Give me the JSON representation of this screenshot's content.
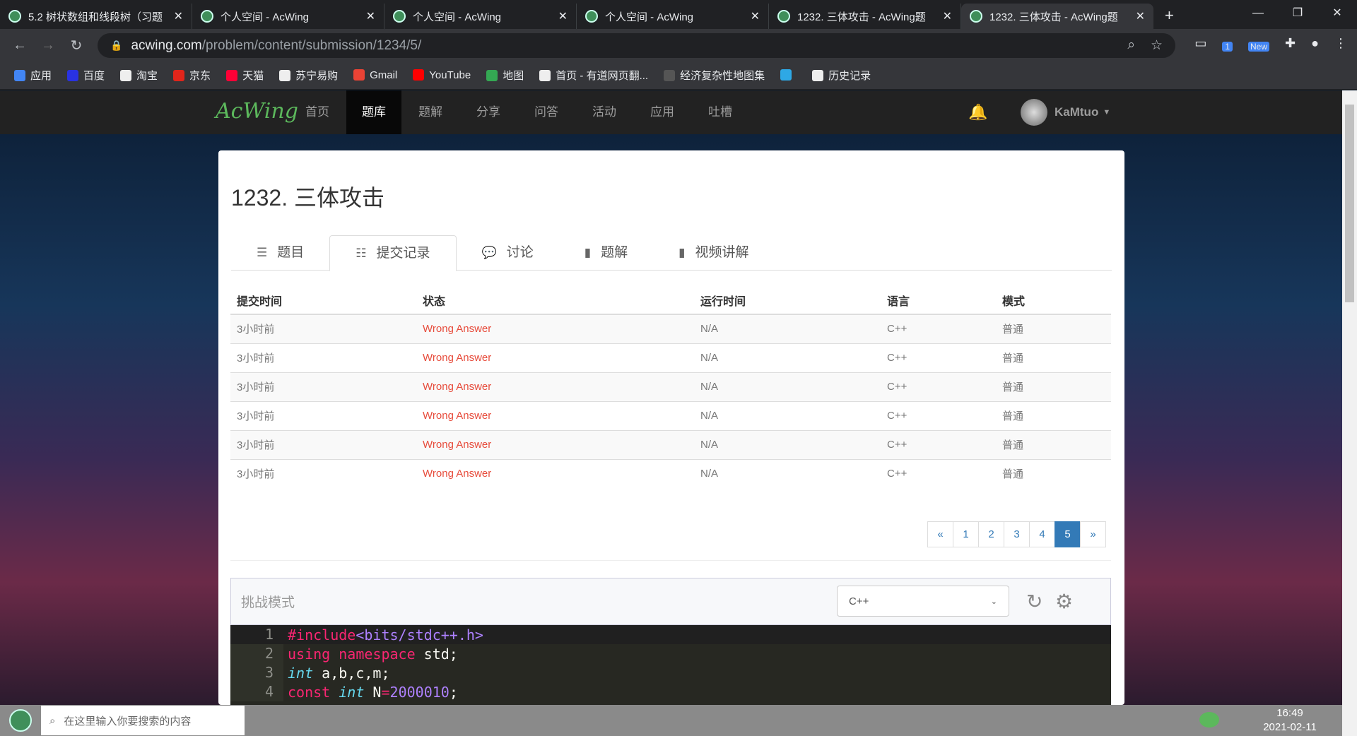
{
  "browser": {
    "tabs": [
      {
        "title": "5.2 树状数组和线段树（习题"
      },
      {
        "title": "个人空间 - AcWing"
      },
      {
        "title": "个人空间 - AcWing"
      },
      {
        "title": "个人空间 - AcWing"
      },
      {
        "title": "1232. 三体攻击 - AcWing题"
      },
      {
        "title": "1232. 三体攻击 - AcWing题",
        "active": true
      }
    ],
    "url_host": "acwing.com",
    "url_path": "/problem/content/submission/1234/5/",
    "bookmarks": [
      {
        "label": "应用",
        "color": "#4285f4"
      },
      {
        "label": "百度",
        "color": "#2932e1"
      },
      {
        "label": "淘宝",
        "color": "#eee"
      },
      {
        "label": "京东",
        "color": "#e1251b"
      },
      {
        "label": "天猫",
        "color": "#ff0036"
      },
      {
        "label": "苏宁易购",
        "color": "#eee"
      },
      {
        "label": "Gmail",
        "color": "#ea4335"
      },
      {
        "label": "YouTube",
        "color": "#ff0000"
      },
      {
        "label": "地图",
        "color": "#34a853"
      },
      {
        "label": "首页 - 有道网页翻...",
        "color": "#eee"
      },
      {
        "label": "经济复杂性地图集",
        "color": "#555"
      },
      {
        "label": "",
        "color": "#2ea8e5"
      },
      {
        "label": "历史记录",
        "color": "#eee"
      }
    ],
    "ext_badge": "1",
    "ext_new": "New"
  },
  "site": {
    "logo": "AcWing",
    "menu": [
      "首页",
      "题库",
      "题解",
      "分享",
      "问答",
      "活动",
      "应用",
      "吐槽"
    ],
    "active_menu": "题库",
    "username": "KaMtuo"
  },
  "problem": {
    "title": "1232. 三体攻击",
    "tabs": [
      "题目",
      "提交记录",
      "讨论",
      "题解",
      "视频讲解"
    ],
    "active_tab": "提交记录",
    "columns": [
      "提交时间",
      "状态",
      "运行时间",
      "语言",
      "模式"
    ],
    "rows": [
      [
        "3小时前",
        "Wrong Answer",
        "N/A",
        "C++",
        "普通"
      ],
      [
        "3小时前",
        "Wrong Answer",
        "N/A",
        "C++",
        "普通"
      ],
      [
        "3小时前",
        "Wrong Answer",
        "N/A",
        "C++",
        "普通"
      ],
      [
        "3小时前",
        "Wrong Answer",
        "N/A",
        "C++",
        "普通"
      ],
      [
        "3小时前",
        "Wrong Answer",
        "N/A",
        "C++",
        "普通"
      ],
      [
        "3小时前",
        "Wrong Answer",
        "N/A",
        "C++",
        "普通"
      ]
    ],
    "pagination": [
      "«",
      "1",
      "2",
      "3",
      "4",
      "5",
      "»"
    ],
    "current_page": "5"
  },
  "editor": {
    "mode_label": "挑战模式",
    "language": "C++",
    "lines": [
      "1",
      "2",
      "3",
      "4"
    ]
  },
  "taskbar": {
    "search_placeholder": "在这里输入你要搜索的内容",
    "time": "16:49",
    "date": "2021-02-11"
  },
  "colors": {
    "wrong_answer": "#e74c3c",
    "accent": "#337ab7",
    "logo": "#5cb85c"
  }
}
